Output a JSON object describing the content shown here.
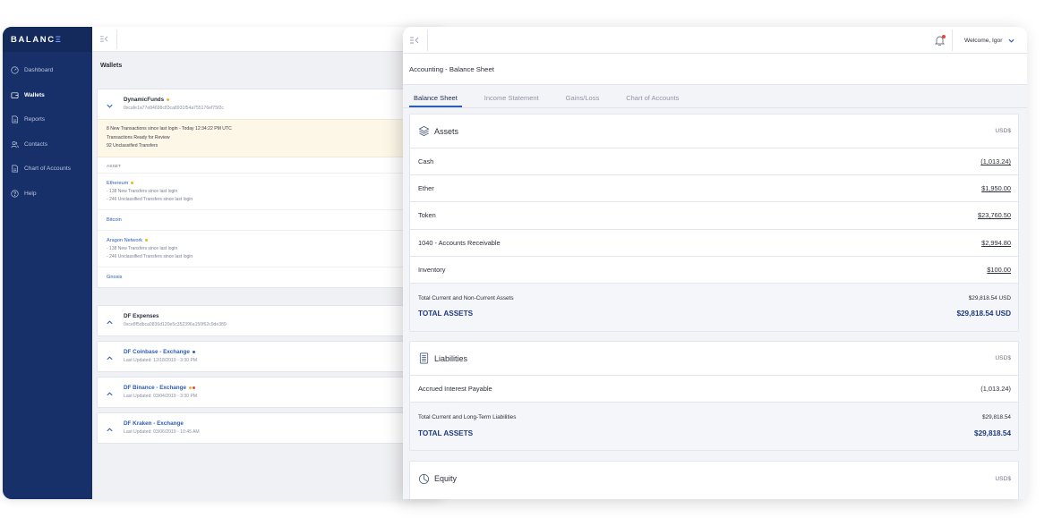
{
  "brand": {
    "name": "BALANC",
    "name_accent": "Ξ"
  },
  "sidebar": {
    "items": [
      {
        "label": "Dashboard",
        "icon": "speedometer-icon",
        "active": false
      },
      {
        "label": "Wallets",
        "icon": "wallet-icon",
        "active": true
      },
      {
        "label": "Reports",
        "icon": "document-icon",
        "active": false
      },
      {
        "label": "Contacts",
        "icon": "users-icon",
        "active": false
      },
      {
        "label": "Chart of Accounts",
        "icon": "document-icon",
        "active": false
      },
      {
        "label": "Help",
        "icon": "question-circle-icon",
        "active": false
      }
    ]
  },
  "wallets_pane": {
    "title": "Wallets",
    "cards": [
      {
        "name": "DynamicFunds",
        "address": "0xcafe1a77e84698c83ca8931f54a755176ef75f2c",
        "notice": [
          "8 New Transactions since last login -  Today 12:34:22 PM UTC",
          "Transactions Ready for Review",
          "92 Unclassified Transfers"
        ],
        "asset_header": "ASSET",
        "assets": [
          {
            "name": "Ethereum",
            "notes": [
              "- 138 New Transfers since last login",
              "- 246 Unclassified Transfers since last login"
            ]
          },
          {
            "name": "Bitcoin",
            "notes": []
          },
          {
            "name": "Aragon Network",
            "notes": [
              "- 138 New Transfers since last login",
              "- 246 Unclassified Transfers since last login"
            ]
          },
          {
            "name": "Gnosis",
            "notes": []
          }
        ]
      },
      {
        "name": "DF Expenses",
        "sub": "0xce8f5dbca0836d120e5c352396a150f62c9de389"
      },
      {
        "name": "DF Coinbase - Exchange",
        "sub": "Last Updated: 12/18/2019 - 3:30 PM"
      },
      {
        "name": "DF Binance - Exchange",
        "sub": "Last Updated: 03/04/2019 - 3:30 PM"
      },
      {
        "name": "DF Kraken - Exchange",
        "sub": "Last Updated: 03/06/2019 - 10:45 AM"
      }
    ]
  },
  "header": {
    "welcome": "Welcome, Igor"
  },
  "main": {
    "title": "Accounting - Balance Sheet",
    "tabs": [
      {
        "label": "Balance Sheet",
        "active": true
      },
      {
        "label": "Income Statement",
        "active": false
      },
      {
        "label": "Gains/Loss",
        "active": false
      },
      {
        "label": "Chart of Accounts",
        "active": false
      }
    ],
    "assets": {
      "title": "Assets",
      "currency": "USD$",
      "rows": [
        {
          "label": "Cash",
          "amount": "(1,013.24)"
        },
        {
          "label": "Ether",
          "amount": "$1,950.00"
        },
        {
          "label": "Token",
          "amount": "$23,760.50"
        },
        {
          "label": "1040 - Accounts Receivable",
          "amount": "$2,994.80"
        },
        {
          "label": "Inventory",
          "amount": "$100.00"
        }
      ],
      "subtotal_label": "Total Current and Non-Current Assets",
      "subtotal_value": "$29,818.54 USD",
      "total_label": "TOTAL ASSETS",
      "total_value": "$29,818.54 USD"
    },
    "liabilities": {
      "title": "Liabilities",
      "currency": "USD$",
      "rows": [
        {
          "label": "Accrued Interest Payable",
          "amount": "(1,013.24)"
        }
      ],
      "subtotal_label": "Total Current and Long-Term Liabilities",
      "subtotal_value": "$29,818.54",
      "total_label": "TOTAL ASSETS",
      "total_value": "$29,818.54"
    },
    "equity": {
      "title": "Equity",
      "currency": "USD$"
    }
  },
  "colors": {
    "sidebar_bg": "#18306a",
    "accent": "#2e5db9",
    "total_text": "#1c3a82",
    "notice_bg": "#fdf7e8",
    "warning_dot": "#f2b231",
    "alert_dot": "#e2483b"
  }
}
